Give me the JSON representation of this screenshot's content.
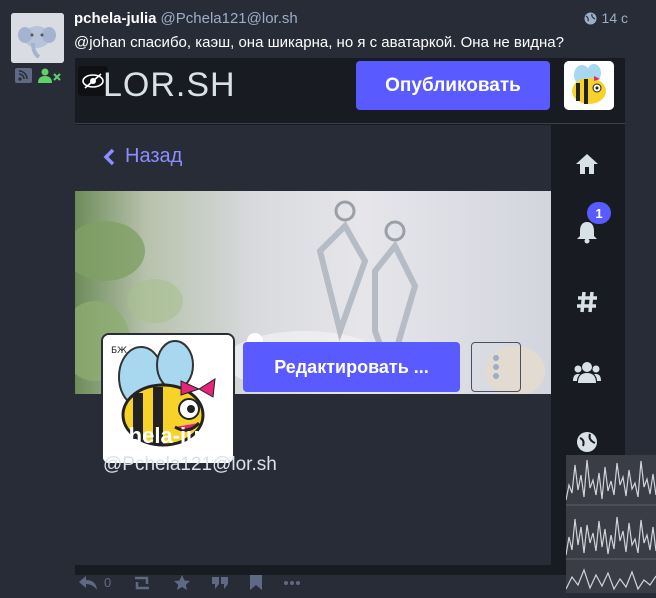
{
  "status": {
    "author_name": "pchela-julia",
    "author_acct": "@Pchela121@lor.sh",
    "time": "14 с",
    "text": "@johan спасибо, каэш, она шикарна, но я с аватаркой. Она не видна?",
    "reply_count": "0"
  },
  "screenshot": {
    "brand": "LOR.SH",
    "publish_label": "Опубликовать",
    "back_label": "Назад",
    "edit_label": "Редактировать ...",
    "profile_name": "pchela-julia",
    "profile_acct": "@Pchela121@lor.sh",
    "notification_count": "1",
    "avatar_text": "БЖ"
  },
  "colors": {
    "accent": "#595aff",
    "background": "#282c37",
    "muted": "#9baec8"
  }
}
